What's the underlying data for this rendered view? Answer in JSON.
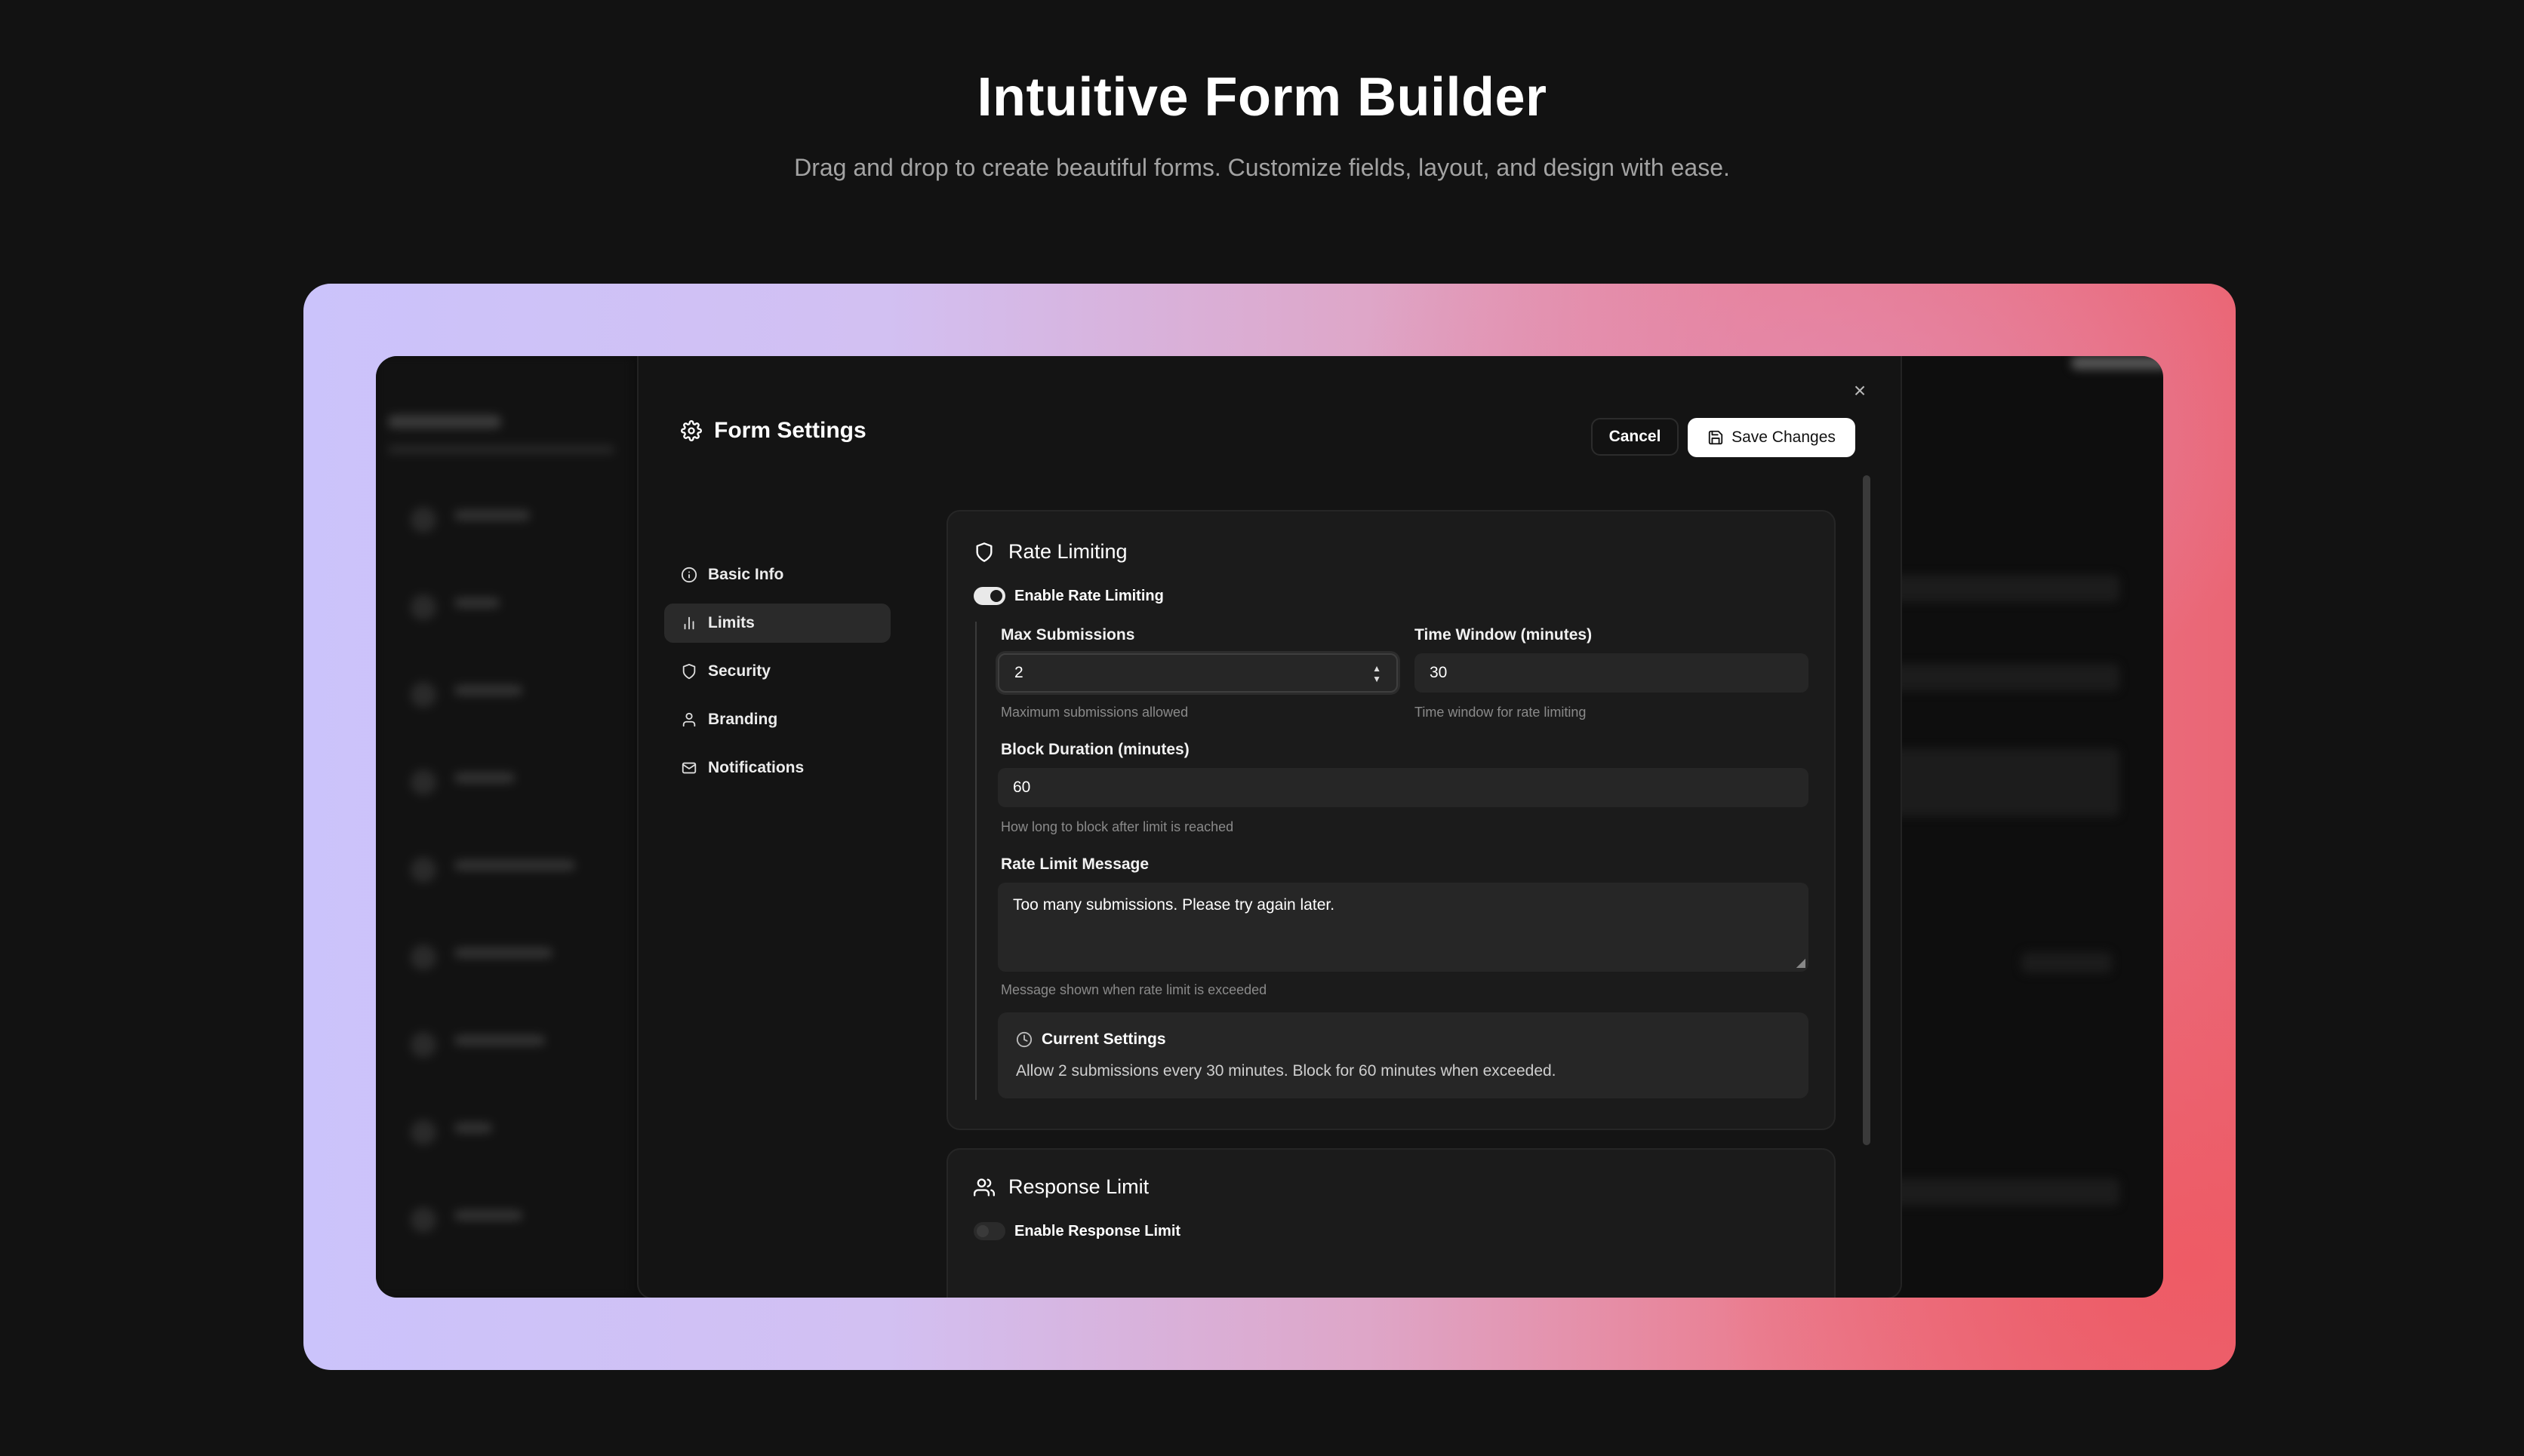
{
  "hero": {
    "title": "Intuitive Form Builder",
    "subtitle": "Drag and drop to create beautiful forms. Customize fields, layout, and design with ease."
  },
  "modal": {
    "title": "Form Settings",
    "close_label": "×",
    "actions": {
      "cancel": "Cancel",
      "save": "Save Changes"
    },
    "nav": [
      {
        "label": "Basic Info",
        "icon": "info-icon",
        "active": false
      },
      {
        "label": "Limits",
        "icon": "bar-chart-icon",
        "active": true
      },
      {
        "label": "Security",
        "icon": "shield-icon",
        "active": false
      },
      {
        "label": "Branding",
        "icon": "user-icon",
        "active": false
      },
      {
        "label": "Notifications",
        "icon": "mail-icon",
        "active": false
      }
    ]
  },
  "rate_limiting": {
    "title": "Rate Limiting",
    "toggle_label": "Enable Rate Limiting",
    "enabled": true,
    "max_submissions": {
      "label": "Max Submissions",
      "value": "2",
      "hint": "Maximum submissions allowed"
    },
    "time_window": {
      "label": "Time Window (minutes)",
      "value": "30",
      "hint": "Time window for rate limiting"
    },
    "block_duration": {
      "label": "Block Duration (minutes)",
      "value": "60",
      "hint": "How long to block after limit is reached"
    },
    "message": {
      "label": "Rate Limit Message",
      "value": "Too many submissions. Please try again later.",
      "hint": "Message shown when rate limit is exceeded"
    },
    "summary": {
      "title": "Current Settings",
      "text": "Allow 2 submissions every 30 minutes. Block for 60 minutes when exceeded."
    }
  },
  "response_limit": {
    "title": "Response Limit",
    "toggle_label": "Enable Response Limit",
    "enabled": false
  },
  "colors": {
    "page_bg": "#121212",
    "modal_bg": "#141414",
    "card_bg": "#1b1b1b",
    "input_bg": "#262626",
    "gradient_left": "#cbc3fb",
    "gradient_right": "#ea6675"
  }
}
